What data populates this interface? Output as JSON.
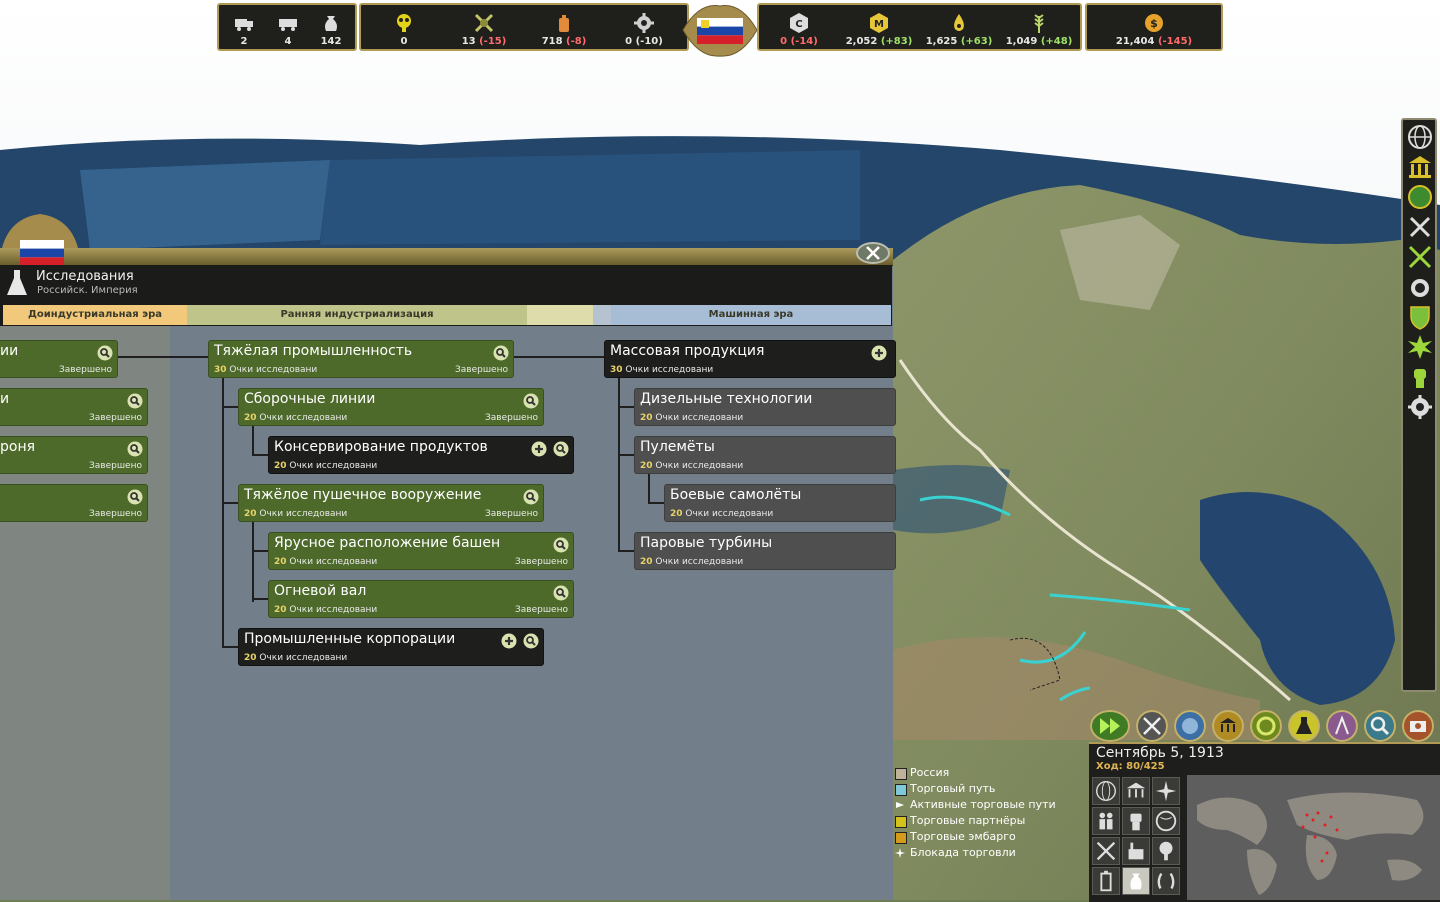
{
  "topbar": {
    "left": [
      {
        "icon": "truck-icon",
        "value": "2"
      },
      {
        "icon": "wagon-icon",
        "value": "4"
      },
      {
        "icon": "grain-sack-icon",
        "value": "142"
      }
    ],
    "middle_left": [
      {
        "icon": "gas-mask-icon",
        "value": "0",
        "delta": ""
      },
      {
        "icon": "crossed-arms-icon",
        "value": "13",
        "delta": "(-15)"
      },
      {
        "icon": "oil-can-icon",
        "value": "718",
        "delta": "(-8)"
      },
      {
        "icon": "gear-icon",
        "value": "0",
        "delta": "(-10)"
      }
    ],
    "middle_right": [
      {
        "icon": "c-badge-icon",
        "value": "0",
        "delta": "(-14)"
      },
      {
        "icon": "m-badge-icon",
        "value": "2,052",
        "delta": "(+83)"
      },
      {
        "icon": "oil-drop-icon",
        "value": "1,625",
        "delta": "(+63)"
      },
      {
        "icon": "wheat-icon",
        "value": "1,049",
        "delta": "(+48)"
      }
    ],
    "money": {
      "icon": "dollar-coin-icon",
      "value": "21,404",
      "delta": "(-145)"
    }
  },
  "research": {
    "title": "Исследования",
    "subtitle": "Российск. Империя",
    "eras": [
      "Доиндустриальная эра",
      "Ранняя индустриализация",
      "Машинная эра"
    ],
    "nodes": {
      "left1": {
        "title": "ии",
        "status": "Завершено"
      },
      "left2": {
        "title": "и",
        "status": "Завершено"
      },
      "left3": {
        "title": "роня",
        "status": "Завершено"
      },
      "left4": {
        "title": "",
        "status": "Завершено"
      },
      "heavy_industry": {
        "title": "Тяжёлая промышленность",
        "points": "30",
        "points_label": "Очки исследовани",
        "status": "Завершено"
      },
      "assembly_lines": {
        "title": "Сборочные линии",
        "points": "20",
        "points_label": "Очки исследовани",
        "status": "Завершено"
      },
      "canning": {
        "title": "Консервирование продуктов",
        "points": "20",
        "points_label": "Очки исследовани"
      },
      "heavy_artillery": {
        "title": "Тяжёлое пушечное вооружение",
        "points": "20",
        "points_label": "Очки исследовани",
        "status": "Завершено"
      },
      "tiered_turrets": {
        "title": "Ярусное расположение башен",
        "points": "20",
        "points_label": "Очки исследовани",
        "status": "Завершено"
      },
      "barrage": {
        "title": "Огневой вал",
        "points": "20",
        "points_label": "Очки исследовани",
        "status": "Завершено"
      },
      "corporations": {
        "title": "Промышленные корпорации",
        "points": "20",
        "points_label": "Очки исследовани"
      },
      "mass_production": {
        "title": "Массовая продукция",
        "points": "30",
        "points_label": "Очки исследовани"
      },
      "diesel": {
        "title": "Дизельные технологии",
        "points": "20",
        "points_label": "Очки исследовани"
      },
      "machine_guns": {
        "title": "Пулемёты",
        "points": "20",
        "points_label": "Очки исследовани"
      },
      "combat_aircraft": {
        "title": "Боевые самолёты",
        "points": "20",
        "points_label": "Очки исследовани"
      },
      "steam_turbines": {
        "title": "Паровые турбины",
        "points": "20",
        "points_label": "Очки исследовани"
      }
    }
  },
  "status": {
    "date": "Сентябрь 5, 1913",
    "turn": "Ход: 80/425"
  },
  "legend": [
    {
      "label": "Россия",
      "color": "#bfb29a"
    },
    {
      "label": "Торговый путь",
      "color": "#7ec8d8"
    },
    {
      "label": "Активные торговые пути",
      "color": "#ffffff"
    },
    {
      "label": "Торговые партнёры",
      "color": "#d4c21c"
    },
    {
      "label": "Торговые эмбарго",
      "color": "#d49a1c"
    },
    {
      "label": "Блокада торговли",
      "color": "#ffffff"
    }
  ],
  "colors": {
    "completed_node": "#4d6a2a",
    "available_node": "#1e1e1c",
    "locked_node": "#4f4f4f",
    "frame_gold": "#b19a55",
    "negative": "#ff6b6b",
    "positive": "#9fe36a"
  }
}
